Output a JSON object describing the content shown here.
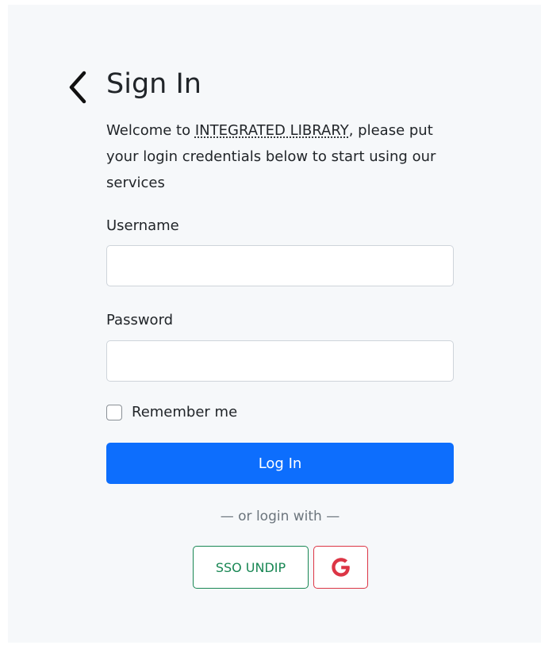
{
  "header": {
    "back_icon": "chevron-left-icon",
    "title": "Sign In"
  },
  "welcome": {
    "prefix": "Welcome to ",
    "library_name": "INTEGRATED LIBRARY",
    "suffix": ", please put your login credentials below to start using our services"
  },
  "form": {
    "username_label": "Username",
    "username_value": "",
    "username_placeholder": "",
    "password_label": "Password",
    "password_value": "",
    "password_placeholder": "",
    "remember_label": "Remember me",
    "remember_checked": false,
    "login_label": "Log In"
  },
  "alt_login": {
    "divider": "— or login with —",
    "sso_label": "SSO UNDIP",
    "google_icon": "google-icon"
  },
  "colors": {
    "primary": "#0d6efd",
    "success": "#198754",
    "danger": "#dc3545",
    "panel_bg": "#f6f8fa"
  }
}
